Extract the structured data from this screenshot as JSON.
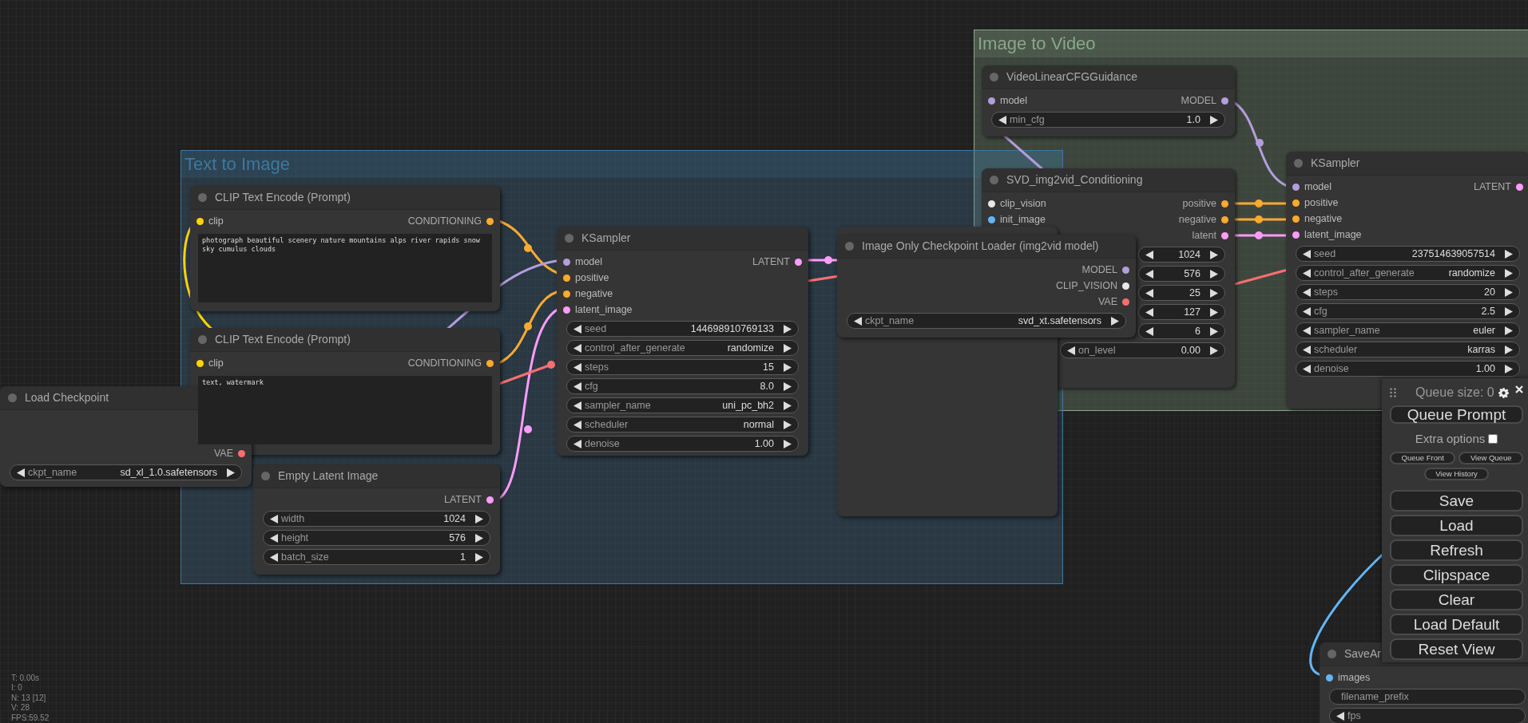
{
  "groups": [
    {
      "title": "Image to Video",
      "color": "#88a888"
    },
    {
      "title": "Text to Image",
      "color": "#3f789e"
    }
  ],
  "nodes": [
    {
      "title": "CLIP Text Encode (Prompt)",
      "inputs": [
        {
          "name": "clip",
          "color": "#ffd500"
        }
      ],
      "outputs": [
        {
          "name": "CONDITIONING",
          "color": "#ffa931"
        }
      ],
      "prompt": "photograph beautiful scenery nature mountains alps river rapids snow sky cumulus clouds"
    },
    {
      "title": "CLIP Text Encode (Prompt)",
      "inputs": [
        {
          "name": "clip",
          "color": "#ffd500"
        }
      ],
      "outputs": [
        {
          "name": "CONDITIONING",
          "color": "#ffa931"
        }
      ],
      "prompt": "text, watermark"
    },
    {
      "title": "Load Checkpoint",
      "outputs": [
        {
          "name": "VAE",
          "color": "#ff6e6e"
        }
      ],
      "widgets": [
        {
          "kind": "combo",
          "name": "ckpt_name",
          "value": "sd_xl_1.0.safetensors"
        }
      ]
    },
    {
      "title": "Empty Latent Image",
      "outputs": [
        {
          "name": "LATENT",
          "color": "#ff9cf9"
        }
      ],
      "widgets": [
        {
          "kind": "number",
          "name": "width",
          "value": "1024"
        },
        {
          "kind": "number",
          "name": "height",
          "value": "576"
        },
        {
          "kind": "number",
          "name": "batch_size",
          "value": "1"
        }
      ]
    },
    {
      "title": "KSampler",
      "inputs": [
        {
          "name": "model",
          "color": "#b39ddb"
        },
        {
          "name": "positive",
          "color": "#ffa931"
        },
        {
          "name": "negative",
          "color": "#ffa931"
        },
        {
          "name": "latent_image",
          "color": "#ff9cf9"
        }
      ],
      "outputs": [
        {
          "name": "LATENT",
          "color": "#ff9cf9"
        }
      ],
      "widgets": [
        {
          "kind": "number",
          "name": "seed",
          "value": "144698910769133"
        },
        {
          "kind": "combo",
          "name": "control_after_generate",
          "value": "randomize"
        },
        {
          "kind": "number",
          "name": "steps",
          "value": "15"
        },
        {
          "kind": "number",
          "name": "cfg",
          "value": "8.0"
        },
        {
          "kind": "combo",
          "name": "sampler_name",
          "value": "uni_pc_bh2"
        },
        {
          "kind": "combo",
          "name": "scheduler",
          "value": "normal"
        },
        {
          "kind": "number",
          "name": "denoise",
          "value": "1.00"
        }
      ]
    },
    {
      "title": "VideoLinearCFGGuidance",
      "inputs": [
        {
          "name": "model",
          "color": "#b39ddb"
        }
      ],
      "outputs": [
        {
          "name": "MODEL",
          "color": "#b39ddb"
        }
      ],
      "widgets": [
        {
          "kind": "number",
          "name": "min_cfg",
          "value": "1.0"
        }
      ]
    },
    {
      "title": "SVD_img2vid_Conditioning",
      "inputs": [
        {
          "name": "clip_vision",
          "color": "#e8e8e8"
        },
        {
          "name": "init_image",
          "color": "#64b5f6"
        }
      ],
      "outputs": [
        {
          "name": "positive",
          "color": "#ffa931"
        },
        {
          "name": "negative",
          "color": "#ffa931"
        },
        {
          "name": "latent",
          "color": "#ff9cf9"
        }
      ],
      "widgets": [
        {
          "kind": "number",
          "value": "1024"
        },
        {
          "kind": "number",
          "value": "576"
        },
        {
          "kind": "number",
          "value": "25"
        },
        {
          "kind": "number",
          "value": "127"
        },
        {
          "kind": "number",
          "value": "6"
        },
        {
          "kind": "number",
          "name": "on_level",
          "value": "0.00"
        }
      ]
    },
    {
      "title": "Image Only Checkpoint Loader (img2vid model)",
      "outputs": [
        {
          "name": "MODEL",
          "color": "#b39ddb"
        },
        {
          "name": "CLIP_VISION",
          "color": "#e8e8e8"
        },
        {
          "name": "VAE",
          "color": "#ff6e6e"
        }
      ],
      "widgets": [
        {
          "kind": "combo",
          "name": "ckpt_name",
          "value": "svd_xt.safetensors"
        }
      ]
    },
    {
      "title": "KSampler",
      "inputs": [
        {
          "name": "model",
          "color": "#b39ddb"
        },
        {
          "name": "positive",
          "color": "#ffa931"
        },
        {
          "name": "negative",
          "color": "#ffa931"
        },
        {
          "name": "latent_image",
          "color": "#ff9cf9"
        }
      ],
      "outputs": [
        {
          "name": "LATENT",
          "color": "#ff9cf9"
        }
      ],
      "widgets": [
        {
          "kind": "number",
          "name": "seed",
          "value": "237514639057514"
        },
        {
          "kind": "combo",
          "name": "control_after_generate",
          "value": "randomize"
        },
        {
          "kind": "number",
          "name": "steps",
          "value": "20"
        },
        {
          "kind": "number",
          "name": "cfg",
          "value": "2.5"
        },
        {
          "kind": "combo",
          "name": "sampler_name",
          "value": "euler"
        },
        {
          "kind": "combo",
          "name": "scheduler",
          "value": "karras"
        },
        {
          "kind": "number",
          "name": "denoise",
          "value": "1.00"
        }
      ]
    },
    {
      "title": "SaveAr",
      "inputs": [
        {
          "name": "images",
          "color": "#64b5f6"
        }
      ],
      "widgets": [
        {
          "kind": "text",
          "name": "filename_prefix"
        },
        {
          "kind": "number",
          "name": "fps"
        }
      ]
    }
  ],
  "queue_panel": {
    "queue_size": "Queue size: 0",
    "primary_button": "Queue Prompt",
    "extra_options": {
      "label": "Extra options",
      "checked": false
    },
    "small_buttons": [
      "Queue Front",
      "View Queue"
    ],
    "history_button": "View History",
    "buttons": [
      "Save",
      "Load",
      "Refresh",
      "Clipspace",
      "Clear",
      "Load Default",
      "Reset View"
    ]
  },
  "stats": [
    "T: 0.00s",
    "I: 0",
    "N: 13 [12]",
    "V: 28",
    "FPS:59.52"
  ]
}
